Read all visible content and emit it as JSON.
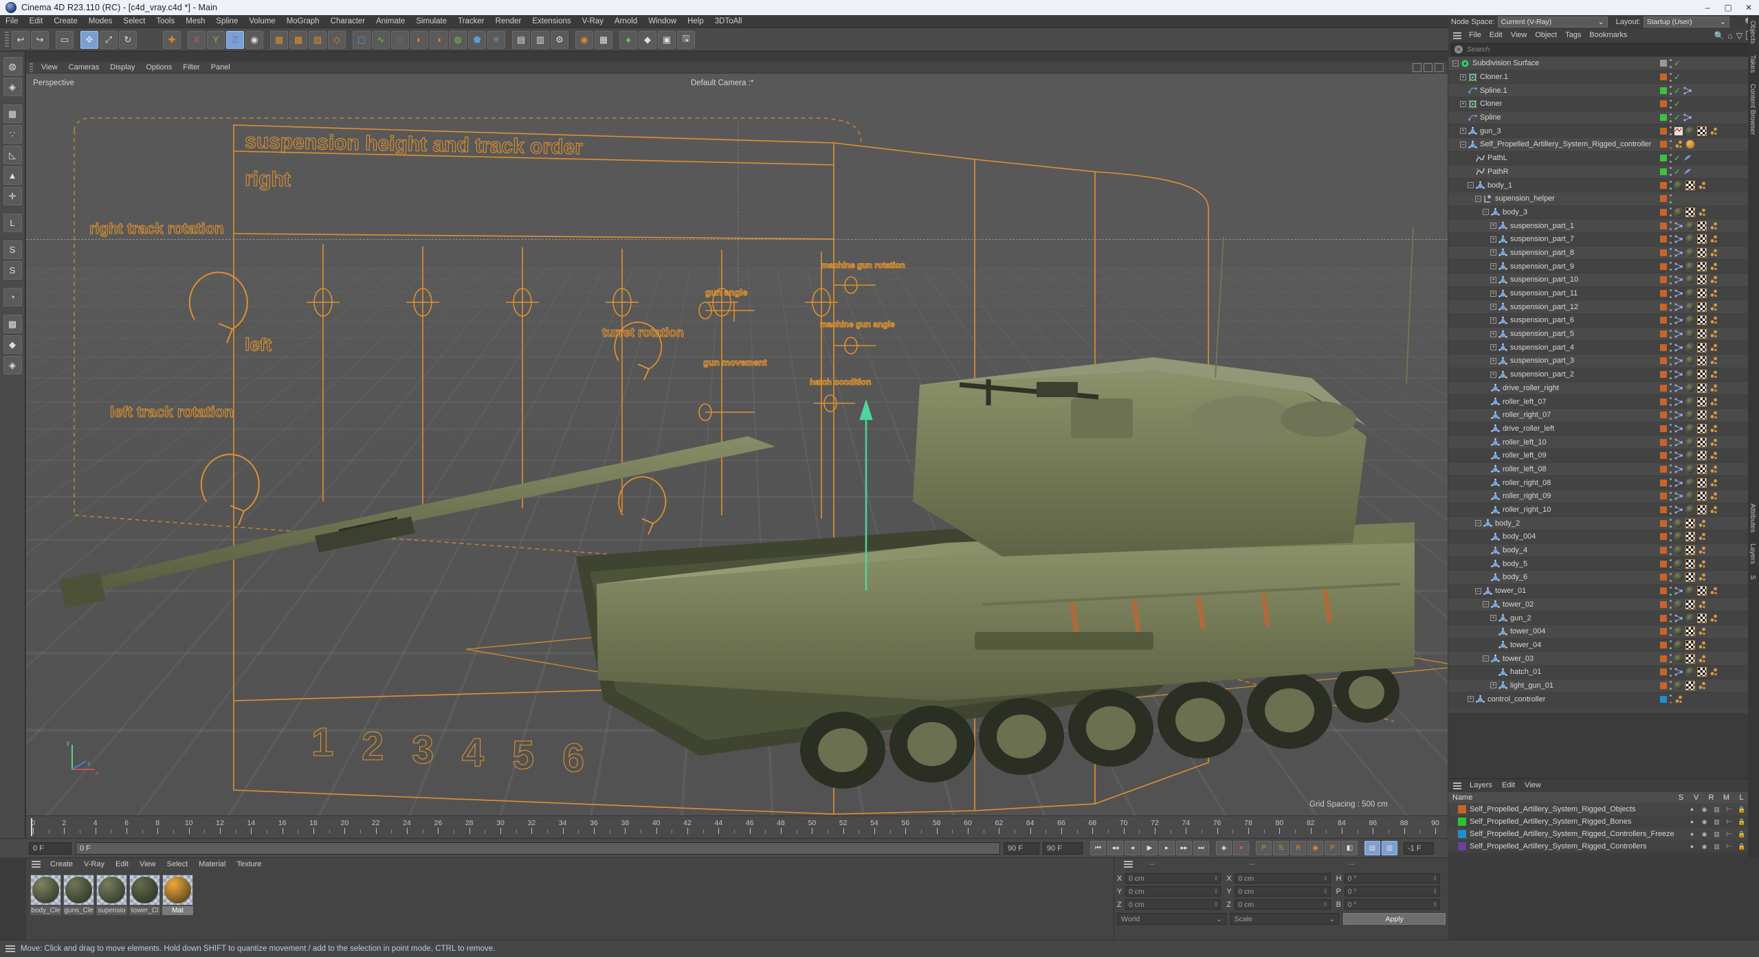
{
  "window": {
    "title": "Cinema 4D R23.110 (RC) - [c4d_vray.c4d *] - Main",
    "minimize": "–",
    "maximize": "▢",
    "close": "✕"
  },
  "menubar": {
    "items": [
      "File",
      "Edit",
      "Create",
      "Modes",
      "Select",
      "Tools",
      "Mesh",
      "Spline",
      "Volume",
      "MoGraph",
      "Character",
      "Animate",
      "Simulate",
      "Tracker",
      "Render",
      "Extensions",
      "V-Ray",
      "Arnold",
      "Window",
      "Help",
      "3DToAll"
    ]
  },
  "viewport": {
    "menu": [
      "View",
      "Cameras",
      "Display",
      "Options",
      "Filter",
      "Panel"
    ],
    "perspective_label": "Perspective",
    "camera_label": "Default Camera :*",
    "grid_spacing": "Grid Spacing : 500 cm",
    "axis": {
      "x": "x",
      "y": "y",
      "z": "z"
    },
    "annotations": {
      "title": "suspension height and track order",
      "right": "right",
      "left": "left",
      "right_track_rotation": "right track rotation",
      "left_track_rotation": "left track rotation",
      "numbers": [
        "1",
        "2",
        "3",
        "4",
        "5",
        "6"
      ],
      "turret_rotation": "turret rotation",
      "gun_angle": "gun angle",
      "gun_movement": "gun movement",
      "machine_gun_rotation": "machine gun rotation",
      "machine_gun_angle": "machine gun angle",
      "hatch_condition": "hatch condition"
    }
  },
  "timeline": {
    "ticks": [
      0,
      2,
      4,
      6,
      8,
      10,
      12,
      14,
      16,
      18,
      20,
      22,
      24,
      26,
      28,
      30,
      32,
      34,
      36,
      38,
      40,
      42,
      44,
      46,
      48,
      50,
      52,
      54,
      56,
      58,
      60,
      62,
      64,
      66,
      68,
      70,
      72,
      74,
      76,
      78,
      80,
      82,
      84,
      86,
      88,
      90
    ],
    "current_frame": "0 F",
    "playhead_label": "0 F",
    "end_frame_left": "90 F",
    "end_frame_right": "90 F",
    "fps_badge": "-1 F"
  },
  "materials": {
    "menu": [
      "Create",
      "V-Ray",
      "Edit",
      "View",
      "Select",
      "Material",
      "Texture"
    ],
    "items": [
      {
        "name": "body_Cle",
        "color": "#7e8463",
        "selected": false
      },
      {
        "name": "guns_Cle",
        "color": "#6f7657",
        "selected": false
      },
      {
        "name": "supensio",
        "color": "#787e5e",
        "selected": false
      },
      {
        "name": "tower_Cl",
        "color": "#656b4e",
        "selected": false
      },
      {
        "name": "Mat",
        "color": "#f0a93a",
        "selected": true
      }
    ]
  },
  "coordinates": {
    "header": [
      "--",
      "--",
      "--"
    ],
    "position": {
      "label_x": "X",
      "label_y": "Y",
      "label_z": "Z",
      "x": "0 cm",
      "y": "0 cm",
      "z": "0 cm"
    },
    "size": {
      "label_x": "X",
      "label_y": "Y",
      "label_z": "Z",
      "x": "0 cm",
      "y": "0 cm",
      "z": "0 cm"
    },
    "rotation": {
      "label_h": "H",
      "label_p": "P",
      "label_b": "B",
      "h": "0 °",
      "p": "0 °",
      "b": "0 °"
    },
    "system": "World",
    "mode": "Scale",
    "apply": "Apply"
  },
  "statusbar": {
    "message": "Move: Click and drag to move elements. Hold down SHIFT to quantize movement / add to the selection in point mode, CTRL to remove."
  },
  "object_manager": {
    "node_space_label": "Node Space:",
    "node_space_value": "Current (V-Ray)",
    "layout_label": "Layout:",
    "layout_value": "Startup (User)",
    "menu": [
      "File",
      "Edit",
      "View",
      "Object",
      "Tags",
      "Bookmarks"
    ],
    "search_placeholder": "Search",
    "side_tabs": [
      "Objects",
      "Takes",
      "Content Browser"
    ],
    "rows": [
      {
        "name": "Subdivision Surface",
        "depth": 0,
        "expander": "minus",
        "icon": "subdivision-surface",
        "layer": "#9a9a9a",
        "dots": "gray",
        "tags": [
          "visible-check"
        ]
      },
      {
        "name": "Cloner.1",
        "depth": 1,
        "expander": "plus",
        "icon": "cloner",
        "layer": "#c8642a",
        "dots": "gray",
        "tags": [
          "visible-check"
        ]
      },
      {
        "name": "Spline.1",
        "depth": 1,
        "expander": "none",
        "icon": "spline",
        "layer": "#3fc03f",
        "dots": "gray",
        "tags": [
          "visible-check",
          "wire"
        ]
      },
      {
        "name": "Cloner",
        "depth": 1,
        "expander": "plus",
        "icon": "cloner",
        "layer": "#c8642a",
        "dots": "gray",
        "tags": [
          "visible-check"
        ]
      },
      {
        "name": "Spline",
        "depth": 1,
        "expander": "none",
        "icon": "spline",
        "layer": "#3fc03f",
        "dots": "gray",
        "tags": [
          "visible-check",
          "wire"
        ]
      },
      {
        "name": "gun_3",
        "depth": 1,
        "expander": "plus",
        "icon": "polygon",
        "layer": "#c8642a",
        "dots": "gray",
        "tags": [
          "weight",
          "material-dark",
          "uv",
          "phong"
        ]
      },
      {
        "name": "Self_Propelled_Artillery_System_Rigged_controller",
        "depth": 1,
        "expander": "minus",
        "icon": "polygon",
        "layer": "#c8642a",
        "dots": "red",
        "tags": [
          "phong",
          "material-orange"
        ]
      },
      {
        "name": "PathL",
        "depth": 2,
        "expander": "none",
        "icon": "path",
        "layer": "#3fc03f",
        "dots": "gray",
        "tags": [
          "visible-check",
          "align"
        ]
      },
      {
        "name": "PathR",
        "depth": 2,
        "expander": "none",
        "icon": "path",
        "layer": "#3fc03f",
        "dots": "gray",
        "tags": [
          "visible-check",
          "align"
        ]
      },
      {
        "name": "body_1",
        "depth": 2,
        "expander": "minus",
        "icon": "polygon",
        "layer": "#c8642a",
        "dots": "green",
        "tags": [
          "material-dark",
          "uv",
          "phong"
        ]
      },
      {
        "name": "supension_helper",
        "depth": 3,
        "expander": "minus",
        "icon": "null",
        "layer": "#c8642a",
        "dots": "green",
        "tags": []
      },
      {
        "name": "body_3",
        "depth": 4,
        "expander": "minus",
        "icon": "polygon",
        "layer": "#c8642a",
        "dots": "gray",
        "tags": [
          "material-dark",
          "uv",
          "phong"
        ]
      },
      {
        "name": "suspension_part_1",
        "depth": 5,
        "expander": "plus",
        "icon": "polygon",
        "layer": "#c8642a",
        "dots": "gray",
        "tags": [
          "wire",
          "material-dark",
          "uv",
          "phong"
        ]
      },
      {
        "name": "suspension_part_7",
        "depth": 5,
        "expander": "plus",
        "icon": "polygon",
        "layer": "#c8642a",
        "dots": "gray",
        "tags": [
          "wire",
          "material-dark",
          "uv",
          "phong"
        ]
      },
      {
        "name": "suspension_part_8",
        "depth": 5,
        "expander": "plus",
        "icon": "polygon",
        "layer": "#c8642a",
        "dots": "gray",
        "tags": [
          "wire",
          "material-dark",
          "uv",
          "phong"
        ]
      },
      {
        "name": "suspension_part_9",
        "depth": 5,
        "expander": "plus",
        "icon": "polygon",
        "layer": "#c8642a",
        "dots": "gray",
        "tags": [
          "wire",
          "material-dark",
          "uv",
          "phong"
        ]
      },
      {
        "name": "suspension_part_10",
        "depth": 5,
        "expander": "plus",
        "icon": "polygon",
        "layer": "#c8642a",
        "dots": "gray",
        "tags": [
          "wire",
          "material-dark",
          "uv",
          "phong"
        ]
      },
      {
        "name": "suspension_part_11",
        "depth": 5,
        "expander": "plus",
        "icon": "polygon",
        "layer": "#c8642a",
        "dots": "gray",
        "tags": [
          "wire",
          "material-dark",
          "uv",
          "phong"
        ]
      },
      {
        "name": "suspension_part_12",
        "depth": 5,
        "expander": "plus",
        "icon": "polygon",
        "layer": "#c8642a",
        "dots": "gray",
        "tags": [
          "wire",
          "material-dark",
          "uv",
          "phong"
        ]
      },
      {
        "name": "suspension_part_6",
        "depth": 5,
        "expander": "plus",
        "icon": "polygon",
        "layer": "#c8642a",
        "dots": "gray",
        "tags": [
          "wire",
          "material-dark",
          "uv",
          "phong"
        ]
      },
      {
        "name": "suspension_part_5",
        "depth": 5,
        "expander": "plus",
        "icon": "polygon",
        "layer": "#c8642a",
        "dots": "gray",
        "tags": [
          "wire",
          "material-dark",
          "uv",
          "phong"
        ]
      },
      {
        "name": "suspension_part_4",
        "depth": 5,
        "expander": "plus",
        "icon": "polygon",
        "layer": "#c8642a",
        "dots": "gray",
        "tags": [
          "wire",
          "material-dark",
          "uv",
          "phong"
        ]
      },
      {
        "name": "suspension_part_3",
        "depth": 5,
        "expander": "plus",
        "icon": "polygon",
        "layer": "#c8642a",
        "dots": "gray",
        "tags": [
          "wire",
          "material-dark",
          "uv",
          "phong"
        ]
      },
      {
        "name": "suspension_part_2",
        "depth": 5,
        "expander": "plus",
        "icon": "polygon",
        "layer": "#c8642a",
        "dots": "gray",
        "tags": [
          "wire",
          "material-dark",
          "uv",
          "phong"
        ]
      },
      {
        "name": "drive_roller_right",
        "depth": 4,
        "expander": "none",
        "icon": "polygon",
        "layer": "#c8642a",
        "dots": "gray",
        "tags": [
          "wire",
          "material-dark",
          "uv",
          "phong"
        ]
      },
      {
        "name": "roller_left_07",
        "depth": 4,
        "expander": "none",
        "icon": "polygon",
        "layer": "#c8642a",
        "dots": "gray",
        "tags": [
          "wire",
          "material-dark",
          "uv",
          "phong"
        ]
      },
      {
        "name": "roller_right_07",
        "depth": 4,
        "expander": "none",
        "icon": "polygon",
        "layer": "#c8642a",
        "dots": "gray",
        "tags": [
          "wire",
          "material-dark",
          "uv",
          "phong"
        ]
      },
      {
        "name": "drive_roller_left",
        "depth": 4,
        "expander": "none",
        "icon": "polygon",
        "layer": "#c8642a",
        "dots": "gray",
        "tags": [
          "wire",
          "material-dark",
          "uv",
          "phong"
        ]
      },
      {
        "name": "roller_left_10",
        "depth": 4,
        "expander": "none",
        "icon": "polygon",
        "layer": "#c8642a",
        "dots": "gray",
        "tags": [
          "wire",
          "material-dark",
          "uv",
          "phong"
        ]
      },
      {
        "name": "roller_left_09",
        "depth": 4,
        "expander": "none",
        "icon": "polygon",
        "layer": "#c8642a",
        "dots": "gray",
        "tags": [
          "wire",
          "material-dark",
          "uv",
          "phong"
        ]
      },
      {
        "name": "roller_left_08",
        "depth": 4,
        "expander": "none",
        "icon": "polygon",
        "layer": "#c8642a",
        "dots": "gray",
        "tags": [
          "wire",
          "material-dark",
          "uv",
          "phong"
        ]
      },
      {
        "name": "roller_right_08",
        "depth": 4,
        "expander": "none",
        "icon": "polygon",
        "layer": "#c8642a",
        "dots": "gray",
        "tags": [
          "wire",
          "material-dark",
          "uv",
          "phong"
        ]
      },
      {
        "name": "roller_right_09",
        "depth": 4,
        "expander": "none",
        "icon": "polygon",
        "layer": "#c8642a",
        "dots": "gray",
        "tags": [
          "wire",
          "material-dark",
          "uv",
          "phong"
        ]
      },
      {
        "name": "roller_right_10",
        "depth": 4,
        "expander": "none",
        "icon": "polygon",
        "layer": "#c8642a",
        "dots": "gray",
        "tags": [
          "wire",
          "material-dark",
          "uv",
          "phong"
        ]
      },
      {
        "name": "body_2",
        "depth": 3,
        "expander": "minus",
        "icon": "polygon",
        "layer": "#c8642a",
        "dots": "green",
        "tags": [
          "material-dark",
          "uv",
          "phong"
        ]
      },
      {
        "name": "body_004",
        "depth": 4,
        "expander": "none",
        "icon": "polygon",
        "layer": "#c8642a",
        "dots": "gray",
        "tags": [
          "material-dark",
          "uv",
          "phong"
        ]
      },
      {
        "name": "body_4",
        "depth": 4,
        "expander": "none",
        "icon": "polygon",
        "layer": "#c8642a",
        "dots": "gray",
        "tags": [
          "material-dark",
          "uv",
          "phong"
        ]
      },
      {
        "name": "body_5",
        "depth": 4,
        "expander": "none",
        "icon": "polygon",
        "layer": "#c8642a",
        "dots": "gray",
        "tags": [
          "material-dark",
          "uv",
          "phong"
        ]
      },
      {
        "name": "body_6",
        "depth": 4,
        "expander": "none",
        "icon": "polygon",
        "layer": "#c8642a",
        "dots": "gray",
        "tags": [
          "material-dark",
          "uv",
          "phong"
        ]
      },
      {
        "name": "tower_01",
        "depth": 3,
        "expander": "minus",
        "icon": "polygon",
        "layer": "#c8642a",
        "dots": "green",
        "tags": [
          "wire",
          "material-dark",
          "uv",
          "phong"
        ]
      },
      {
        "name": "tower_02",
        "depth": 4,
        "expander": "minus",
        "icon": "polygon",
        "layer": "#c8642a",
        "dots": "gray",
        "tags": [
          "material-dark",
          "uv",
          "phong"
        ]
      },
      {
        "name": "gun_2",
        "depth": 5,
        "expander": "plus",
        "icon": "polygon",
        "layer": "#c8642a",
        "dots": "gray",
        "tags": [
          "wire",
          "material-dark",
          "uv",
          "phong"
        ]
      },
      {
        "name": "tower_004",
        "depth": 5,
        "expander": "none",
        "icon": "polygon",
        "layer": "#c8642a",
        "dots": "gray",
        "tags": [
          "material-dark",
          "uv",
          "phong"
        ]
      },
      {
        "name": "tower_04",
        "depth": 5,
        "expander": "none",
        "icon": "polygon",
        "layer": "#c8642a",
        "dots": "gray",
        "tags": [
          "material-dark",
          "uv",
          "phong"
        ]
      },
      {
        "name": "tower_03",
        "depth": 4,
        "expander": "minus",
        "icon": "polygon",
        "layer": "#c8642a",
        "dots": "gray",
        "tags": [
          "material-dark",
          "uv",
          "phong"
        ]
      },
      {
        "name": "hatch_01",
        "depth": 5,
        "expander": "none",
        "icon": "polygon",
        "layer": "#c8642a",
        "dots": "gray",
        "tags": [
          "wire",
          "material-dark",
          "uv",
          "phong"
        ]
      },
      {
        "name": "light_gun_01",
        "depth": 5,
        "expander": "plus",
        "icon": "polygon",
        "layer": "#c8642a",
        "dots": "gray",
        "tags": [
          "material-dark",
          "uv",
          "phong"
        ]
      },
      {
        "name": "control_controller",
        "depth": 2,
        "expander": "plus",
        "icon": "polygon",
        "layer": "#1f8fd0",
        "dots": "red",
        "tags": [
          "phong"
        ]
      }
    ]
  },
  "layers_panel": {
    "menu": [
      "Layers",
      "Edit",
      "View"
    ],
    "name_header": "Name",
    "columns": [
      "S",
      "V",
      "R",
      "M",
      "L"
    ],
    "side_tabs": [
      "Attributes",
      "Layers",
      "S"
    ],
    "rows": [
      {
        "name": "Self_Propelled_Artillery_System_Rigged_Objects",
        "color": "#c8642a"
      },
      {
        "name": "Self_Propelled_Artillery_System_Rigged_Bones",
        "color": "#2fc22f"
      },
      {
        "name": "Self_Propelled_Artillery_System_Rigged_Controllers_Freeze",
        "color": "#1f8fd0"
      },
      {
        "name": "Self_Propelled_Artillery_System_Rigged_Controllers",
        "color": "#6b3fa0"
      }
    ]
  },
  "colors": {
    "accent_orange": "#e08b2a",
    "selection_blue": "#7b9fd0",
    "layer_green": "#3fc03f",
    "panel_bg": "#3b3b3b",
    "viewport_bg": "#585858"
  }
}
